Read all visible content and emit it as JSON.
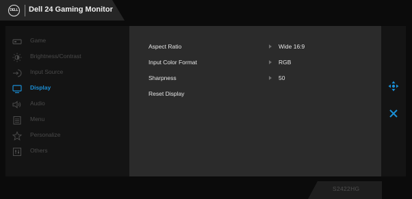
{
  "header": {
    "logo_text": "DELL",
    "title": "Dell 24 Gaming Monitor"
  },
  "menu": {
    "items": [
      {
        "label": "Game",
        "icon": "gamepad-icon",
        "active": false
      },
      {
        "label": "Brightness/Contrast",
        "icon": "brightness-icon",
        "active": false
      },
      {
        "label": "Input Source",
        "icon": "input-source-icon",
        "active": false
      },
      {
        "label": "Display",
        "icon": "display-icon",
        "active": true
      },
      {
        "label": "Audio",
        "icon": "speaker-icon",
        "active": false
      },
      {
        "label": "Menu",
        "icon": "menu-icon",
        "active": false
      },
      {
        "label": "Personalize",
        "icon": "star-icon",
        "active": false
      },
      {
        "label": "Others",
        "icon": "others-icon",
        "active": false
      }
    ]
  },
  "settings": {
    "rows": [
      {
        "label": "Aspect Ratio",
        "value": "Wide 16:9"
      },
      {
        "label": "Input Color Format",
        "value": "RGB"
      },
      {
        "label": "Sharpness",
        "value": "50"
      },
      {
        "label": "Reset Display",
        "value": ""
      }
    ]
  },
  "controls": {
    "nav_icon": "navigate-icon",
    "close_icon": "close-icon"
  },
  "footer": {
    "model_code": "S2422HG"
  },
  "colors": {
    "accent": "#1b8fd6",
    "inactive_text": "#4a4a4a",
    "panel_bg": "#2b2b2b",
    "background": "#0b0b0b"
  }
}
